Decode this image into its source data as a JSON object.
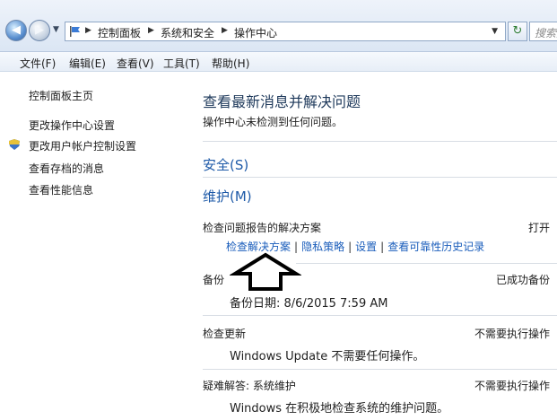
{
  "address_bar": {
    "crumbs": [
      "控制面板",
      "系统和安全",
      "操作中心"
    ],
    "search_placeholder": "搜索控"
  },
  "menu": [
    "文件(F)",
    "编辑(E)",
    "查看(V)",
    "工具(T)",
    "帮助(H)"
  ],
  "sidebar": {
    "items": [
      {
        "label": "控制面板主页"
      },
      {
        "label": "更改操作中心设置"
      },
      {
        "label": "更改用户帐户控制设置"
      },
      {
        "label": "查看存档的消息"
      },
      {
        "label": "查看性能信息"
      }
    ]
  },
  "main": {
    "title": "查看最新消息并解决问题",
    "subtitle": "操作中心未检测到任何问题。",
    "security_label": "安全(S)",
    "maintenance_label": "维护(M)",
    "problem_reports": {
      "title": "检查问题报告的解决方案",
      "status": "打开",
      "links": [
        "检查解决方案",
        "隐私策略",
        "设置",
        "查看可靠性历史记录"
      ]
    },
    "backup": {
      "title": "备份",
      "status": "已成功备份",
      "detail": "备份日期: 8/6/2015 7:59 AM"
    },
    "updates": {
      "title": "检查更新",
      "status": "不需要执行操作",
      "detail": "Windows Update 不需要任何操作。"
    },
    "troubleshoot": {
      "title": "疑难解答: 系统维护",
      "status": "不需要执行操作",
      "detail": "Windows 在积极地检查系统的维护问题。"
    }
  }
}
